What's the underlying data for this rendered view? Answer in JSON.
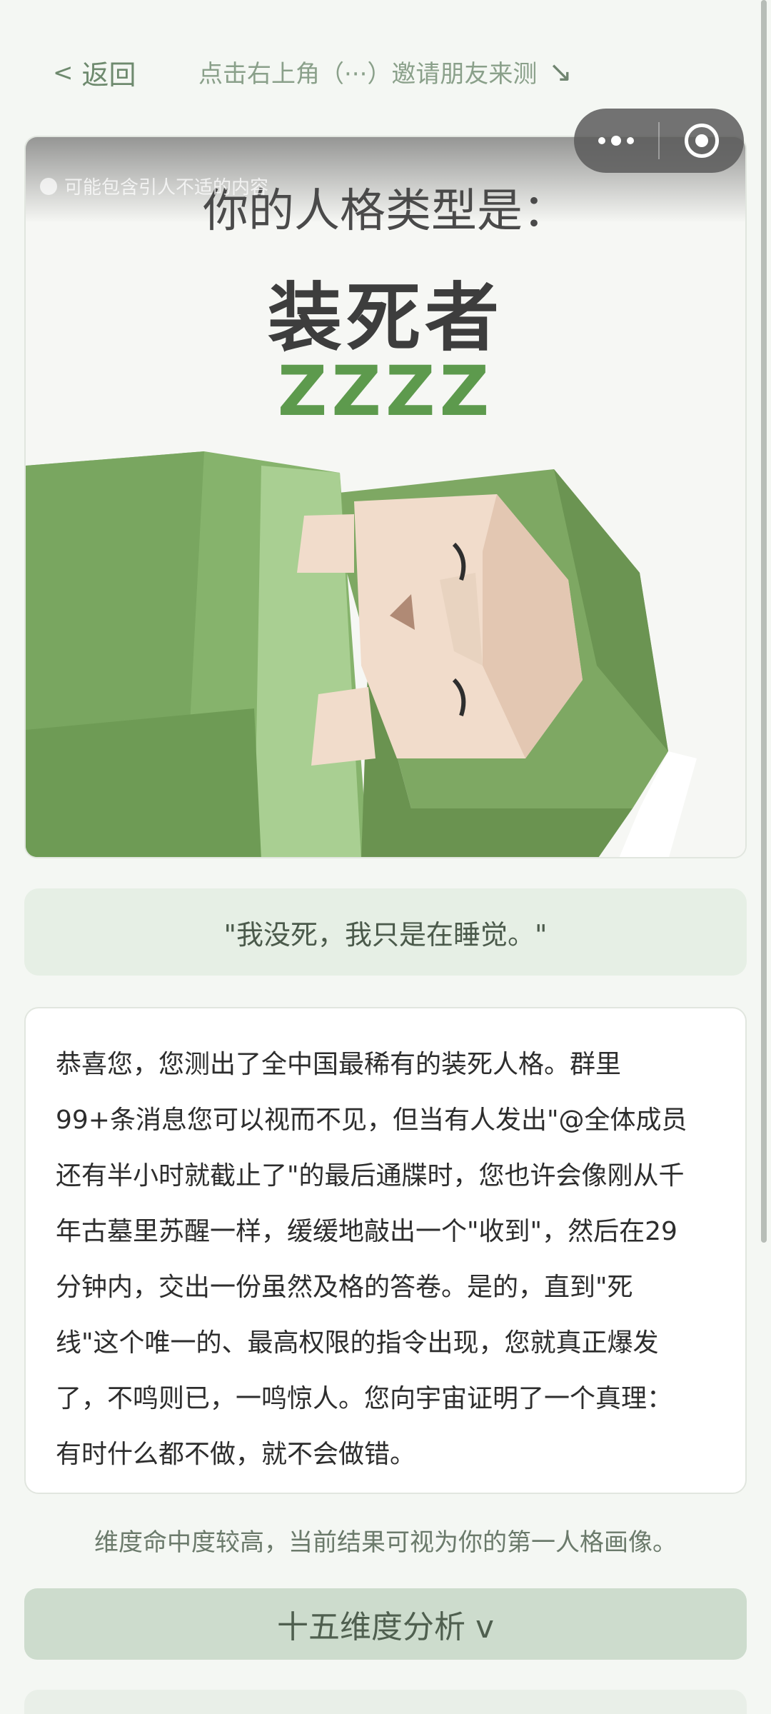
{
  "header": {
    "back_arrow": "<",
    "back_label": "返回",
    "hint": "点击右上角（···）邀请朋友来测",
    "hint_arrow": "↘"
  },
  "image": {
    "warning": "可能包含引人不适的内容",
    "subtitle": "你的人格类型是：",
    "title": "装死者",
    "code": "ZZZZ"
  },
  "quote": "\"我没死，我只是在睡觉。\"",
  "description": "恭喜您，您测出了全中国最稀有的装死人格。群里99+条消息您可以视而不见，但当有人发出\"@全体成员 还有半小时就截止了\"的最后通牒时，您也许会像刚从千年古墓里苏醒一样，缓缓地敲出一个\"收到\"，然后在29分钟内，交出一份虽然及格的答卷。是的，直到\"死线\"这个唯一的、最高权限的指令出现，您就真正爆发了，不鸣则已，一鸣惊人。您向宇宙证明了一个真理：有时什么都不做，就不会做错。",
  "note": "维度命中度较高，当前结果可视为你的第一人格画像。",
  "dimension_button": "十五维度分析 v",
  "colors": {
    "accent_green": "#5d9a4d",
    "button_bg": "#cddccd",
    "quote_bg": "#e6efe5"
  }
}
